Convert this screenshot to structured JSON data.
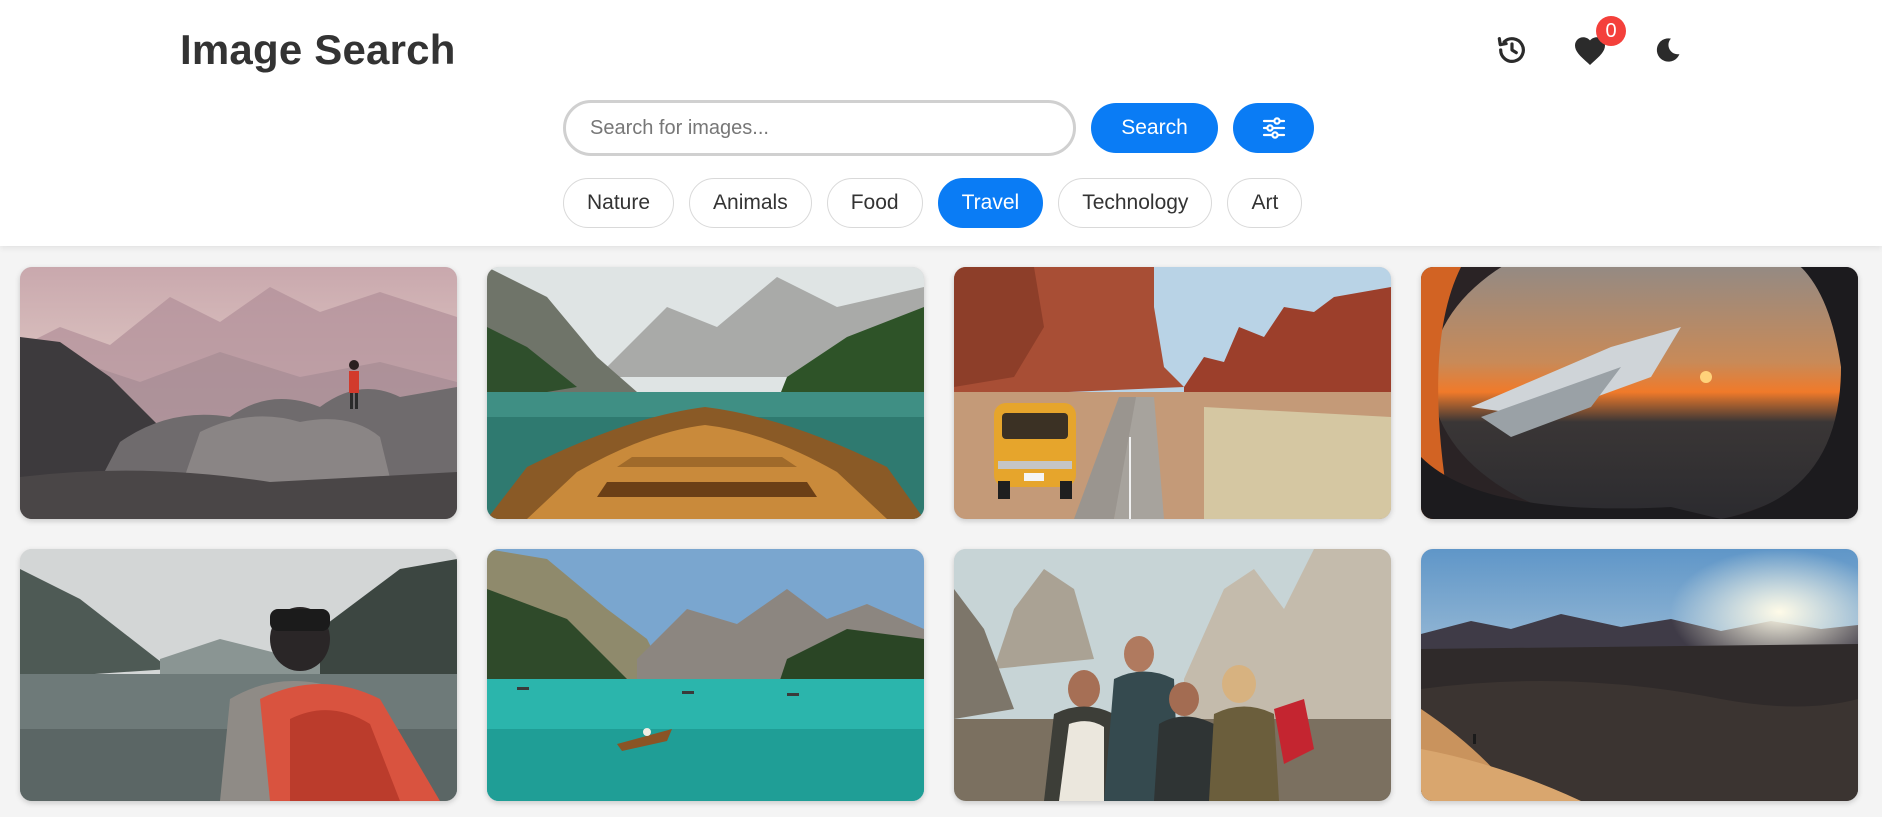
{
  "header": {
    "title": "Image Search",
    "icons": [
      "history-icon",
      "heart-icon",
      "moon-icon"
    ],
    "favorites_count": "0"
  },
  "search": {
    "placeholder": "Search for images...",
    "value": "",
    "button_label": "Search",
    "filter_icon": "sliders-icon"
  },
  "categories": [
    {
      "label": "Nature",
      "active": false
    },
    {
      "label": "Animals",
      "active": false
    },
    {
      "label": "Food",
      "active": false
    },
    {
      "label": "Travel",
      "active": true
    },
    {
      "label": "Technology",
      "active": false
    },
    {
      "label": "Art",
      "active": false
    }
  ],
  "colors": {
    "accent": "#0a7cf5",
    "badge": "#f4403b",
    "page_background": "#f4f4f4"
  }
}
